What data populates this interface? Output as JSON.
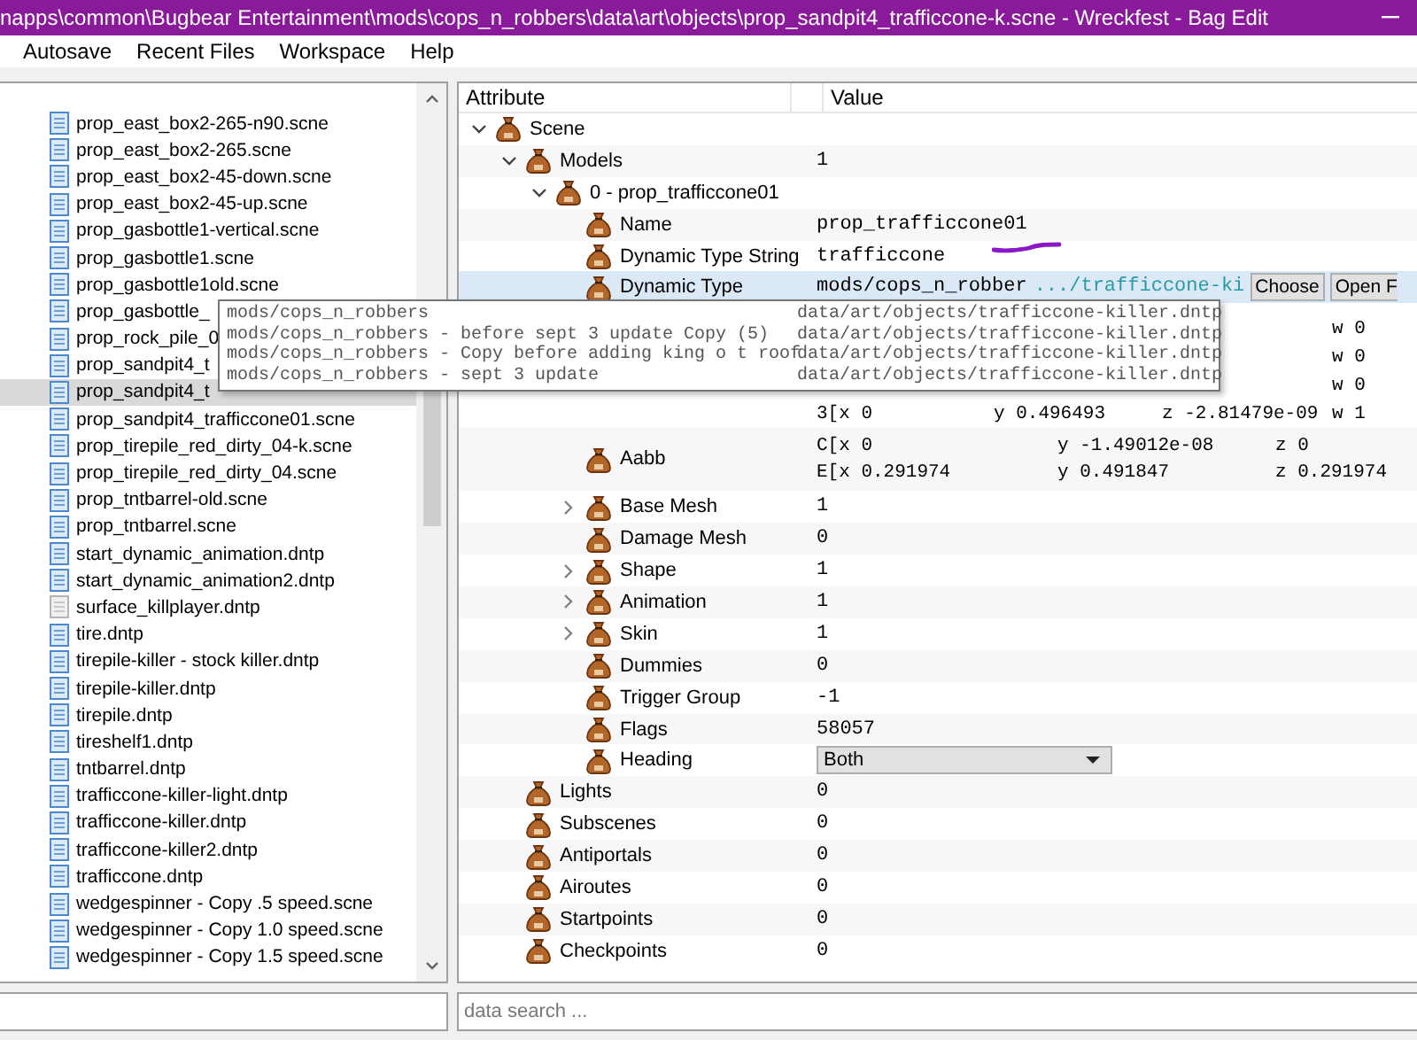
{
  "window": {
    "title": "napps\\common\\Bugbear Entertainment\\mods\\cops_n_robbers\\data\\art\\objects\\prop_sandpit4_trafficcone-k.scne - Wreckfest - Bag Edit"
  },
  "menu": [
    "Autosave",
    "Recent Files",
    "Workspace",
    "Help"
  ],
  "files": [
    {
      "name": "prop_east_box2-265-n90.scne",
      "selected": false,
      "dimmed": false
    },
    {
      "name": "prop_east_box2-265.scne",
      "selected": false,
      "dimmed": false
    },
    {
      "name": "prop_east_box2-45-down.scne",
      "selected": false,
      "dimmed": false
    },
    {
      "name": "prop_east_box2-45-up.scne",
      "selected": false,
      "dimmed": false
    },
    {
      "name": "prop_gasbottle1-vertical.scne",
      "selected": false,
      "dimmed": false
    },
    {
      "name": "prop_gasbottle1.scne",
      "selected": false,
      "dimmed": false
    },
    {
      "name": "prop_gasbottle1old.scne",
      "selected": false,
      "dimmed": false
    },
    {
      "name": "prop_gasbottle_",
      "selected": false,
      "dimmed": false
    },
    {
      "name": "prop_rock_pile_0",
      "selected": false,
      "dimmed": false
    },
    {
      "name": "prop_sandpit4_t",
      "selected": false,
      "dimmed": false
    },
    {
      "name": "prop_sandpit4_t",
      "selected": true,
      "dimmed": false
    },
    {
      "name": "prop_sandpit4_trafficcone01.scne",
      "selected": false,
      "dimmed": false
    },
    {
      "name": "prop_tirepile_red_dirty_04-k.scne",
      "selected": false,
      "dimmed": false
    },
    {
      "name": "prop_tirepile_red_dirty_04.scne",
      "selected": false,
      "dimmed": false
    },
    {
      "name": "prop_tntbarrel-old.scne",
      "selected": false,
      "dimmed": false
    },
    {
      "name": "prop_tntbarrel.scne",
      "selected": false,
      "dimmed": false
    },
    {
      "name": "start_dynamic_animation.dntp",
      "selected": false,
      "dimmed": false
    },
    {
      "name": "start_dynamic_animation2.dntp",
      "selected": false,
      "dimmed": false
    },
    {
      "name": "surface_killplayer.dntp",
      "selected": false,
      "dimmed": true
    },
    {
      "name": "tire.dntp",
      "selected": false,
      "dimmed": false
    },
    {
      "name": "tirepile-killer - stock killer.dntp",
      "selected": false,
      "dimmed": false
    },
    {
      "name": "tirepile-killer.dntp",
      "selected": false,
      "dimmed": false
    },
    {
      "name": "tirepile.dntp",
      "selected": false,
      "dimmed": false
    },
    {
      "name": "tireshelf1.dntp",
      "selected": false,
      "dimmed": false
    },
    {
      "name": "tntbarrel.dntp",
      "selected": false,
      "dimmed": false
    },
    {
      "name": "trafficcone-killer-light.dntp",
      "selected": false,
      "dimmed": false
    },
    {
      "name": "trafficcone-killer.dntp",
      "selected": false,
      "dimmed": false
    },
    {
      "name": "trafficcone-killer2.dntp",
      "selected": false,
      "dimmed": false
    },
    {
      "name": "trafficcone.dntp",
      "selected": false,
      "dimmed": false
    },
    {
      "name": "wedgespinner - Copy .5 speed.scne",
      "selected": false,
      "dimmed": false
    },
    {
      "name": "wedgespinner - Copy 1.0 speed.scne",
      "selected": false,
      "dimmed": false
    },
    {
      "name": "wedgespinner - Copy 1.5 speed.scne",
      "selected": false,
      "dimmed": false
    }
  ],
  "tree": {
    "columns": [
      "Attribute",
      "Value"
    ],
    "rows": [
      {
        "label": "Scene",
        "expanded": true,
        "selected": false,
        "children": [
          {
            "label": "Models",
            "kind": "text",
            "value": "1",
            "expanded": true,
            "selected": false,
            "children": [
              {
                "label": "0 - prop_trafficcone01",
                "expanded": true,
                "selected": false,
                "children": [
                  {
                    "label": "Name",
                    "kind": "text",
                    "value": "prop_trafficcone01",
                    "selected": false
                  },
                  {
                    "label": "Dynamic Type String",
                    "kind": "text",
                    "value": "trafficcone",
                    "selected": false
                  },
                  {
                    "label": "Dynamic Type",
                    "kind": "path",
                    "value": "mods/cops_n_robber",
                    "link": ".../trafficcone-ki",
                    "buttons": [
                      "Choose",
                      "Open F"
                    ],
                    "selected": true
                  },
                  {
                    "kind": "matrix",
                    "selected": false,
                    "lines": [
                      {
                        "w": "w 0"
                      },
                      {
                        "w": "w 0"
                      },
                      {
                        "w": "w 0"
                      },
                      {
                        "x": "3[x 0",
                        "y": "y 0.496493",
                        "z": "z -2.81479e-09",
                        "w": "w 1"
                      }
                    ]
                  },
                  {
                    "label": "Aabb",
                    "kind": "vector",
                    "selected": false,
                    "lines": [
                      {
                        "x": "C[x 0",
                        "y": "y -1.49012e-08",
                        "z": "z 0"
                      },
                      {
                        "x": "E[x 0.291974",
                        "y": "y 0.491847",
                        "z": "z 0.291974"
                      }
                    ]
                  },
                  {
                    "label": "Base Mesh",
                    "kind": "text",
                    "value": "1",
                    "expanded": false,
                    "selected": false
                  },
                  {
                    "label": "Damage Mesh",
                    "kind": "text",
                    "value": "0",
                    "selected": false
                  },
                  {
                    "label": "Shape",
                    "kind": "text",
                    "value": "1",
                    "expanded": false,
                    "selected": false
                  },
                  {
                    "label": "Animation",
                    "kind": "text",
                    "value": "1",
                    "expanded": false,
                    "selected": false
                  },
                  {
                    "label": "Skin",
                    "kind": "text",
                    "value": "1",
                    "expanded": false,
                    "selected": false
                  },
                  {
                    "label": "Dummies",
                    "kind": "text",
                    "value": "0",
                    "selected": false
                  },
                  {
                    "label": "Trigger Group",
                    "kind": "text",
                    "value": "-1",
                    "selected": false
                  },
                  {
                    "label": "Flags",
                    "kind": "text",
                    "value": "58057",
                    "selected": false
                  },
                  {
                    "label": "Heading",
                    "kind": "dropdown",
                    "value": "Both",
                    "selected": false
                  }
                ]
              }
            ]
          },
          {
            "label": "Lights",
            "kind": "text",
            "value": "0",
            "selected": false
          },
          {
            "label": "Subscenes",
            "kind": "text",
            "value": "0",
            "selected": false
          },
          {
            "label": "Antiportals",
            "kind": "text",
            "value": "0",
            "selected": false
          },
          {
            "label": "Airoutes",
            "kind": "text",
            "value": "0",
            "selected": false
          },
          {
            "label": "Startpoints",
            "kind": "text",
            "value": "0",
            "selected": false
          },
          {
            "label": "Checkpoints",
            "kind": "text",
            "value": "0",
            "selected": false
          }
        ]
      }
    ]
  },
  "tooltip": [
    {
      "text": "mods/cops_n_robbers",
      "path": "data/art/objects/trafficcone-killer.dntp"
    },
    {
      "text": "mods/cops_n_robbers - before sept 3 update Copy (5)",
      "path": "data/art/objects/trafficcone-killer.dntp"
    },
    {
      "text": "mods/cops_n_robbers - Copy before adding king o t roof",
      "path": "data/art/objects/trafficcone-killer.dntp"
    },
    {
      "text": "mods/cops_n_robbers - sept 3 update",
      "path": "data/art/objects/trafficcone-killer.dntp"
    }
  ],
  "search": {
    "placeholder": "data search ..."
  }
}
